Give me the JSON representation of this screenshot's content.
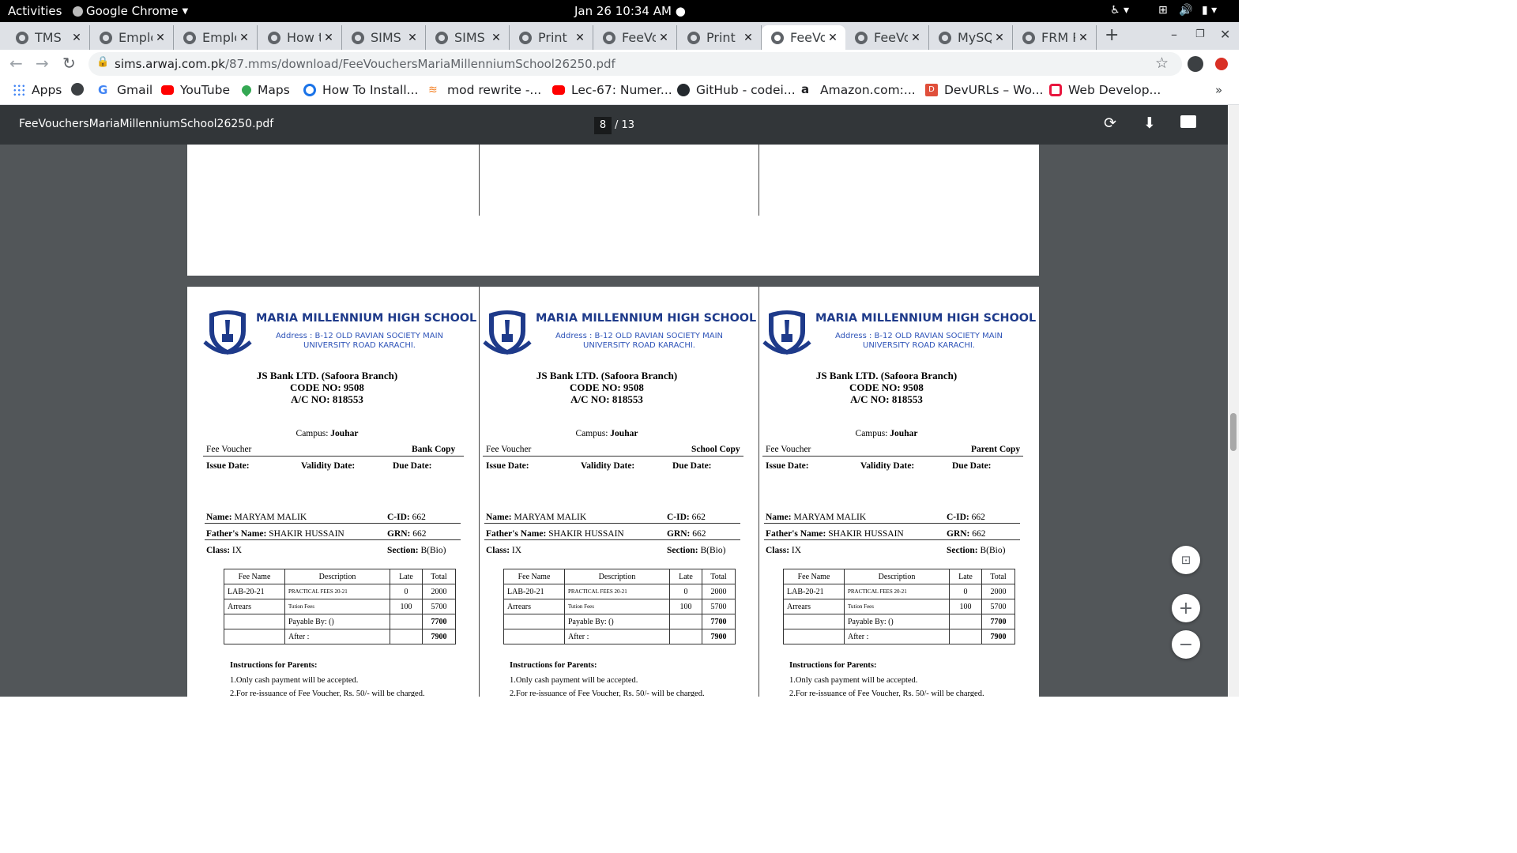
{
  "system": {
    "activities": "Activities",
    "app": "Google Chrome",
    "datetime": "Jan 26  10:34 AM"
  },
  "tabs": [
    {
      "label": "TMS"
    },
    {
      "label": "Emplo"
    },
    {
      "label": "Emplo"
    },
    {
      "label": "How t"
    },
    {
      "label": "SIMS -"
    },
    {
      "label": "SIMS -"
    },
    {
      "label": "Print I"
    },
    {
      "label": "FeeVo"
    },
    {
      "label": "Print I"
    },
    {
      "label": "FeeVo"
    },
    {
      "label": "FeeVo"
    },
    {
      "label": "MySQ"
    },
    {
      "label": "FRM P"
    }
  ],
  "active_tab_index": 9,
  "url": {
    "domain": "sims.arwaj.com.pk",
    "path": "/87.mms/download/FeeVouchersMariaMillenniumSchool26250.pdf"
  },
  "bookmarks": [
    {
      "label": "Apps"
    },
    {
      "label": ""
    },
    {
      "label": "Gmail"
    },
    {
      "label": "YouTube"
    },
    {
      "label": "Maps"
    },
    {
      "label": "How To Install..."
    },
    {
      "label": "mod rewrite -..."
    },
    {
      "label": "Lec-67: Numer..."
    },
    {
      "label": "GitHub - codei..."
    },
    {
      "label": "Amazon.com:..."
    },
    {
      "label": "DevURLs – Wo..."
    },
    {
      "label": "Web Develop..."
    }
  ],
  "pdf": {
    "filename": "FeeVouchersMariaMillenniumSchool26250.pdf",
    "current_page": "8",
    "total_pages": "/ 13"
  },
  "voucher_common": {
    "school": "MARIA MILLENNIUM HIGH SCHOOL",
    "address1": "Address : B-12 OLD RAVIAN SOCIETY MAIN",
    "address2": "UNIVERSITY ROAD KARACHI.",
    "bank": "JS Bank LTD. (Safoora Branch)",
    "code": "CODE NO: 9508",
    "account": "A/C NO: 818553",
    "campus_label": "Campus:",
    "campus": "Jouhar",
    "voucher_label": "Fee Voucher",
    "issue_date": "Issue Date:",
    "validity_date": "Validity Date:",
    "due_date": "Due Date:",
    "name_label": "Name:",
    "name": "MARYAM MALIK",
    "cid_label": "C-ID:",
    "cid": "662",
    "father_label": "Father's Name:",
    "father": "SHAKIR HUSSAIN",
    "grn_label": "GRN:",
    "grn": "662",
    "class_label": "Class:",
    "class": "IX",
    "section_label": "Section:",
    "section": "B(Bio)",
    "table_headers": [
      "Fee Name",
      "Description",
      "Late",
      "Total"
    ],
    "fee_rows": [
      {
        "name": "LAB-20-21",
        "desc": "PRACTICAL FEES 20-21",
        "late": "0",
        "total": "2000"
      },
      {
        "name": "Arrears",
        "desc": "Tution Fees",
        "late": "100",
        "total": "5700"
      }
    ],
    "payable_label": "Payable By: ()",
    "payable_total": "7700",
    "after_label": "After :",
    "after_total": "7900",
    "instructions_title": "Instructions for Parents:",
    "instruction_1": "1.Only cash payment will be accepted.",
    "instruction_2": "2.For re-issuance of Fee Voucher, Rs. 50/- will be charged."
  },
  "copies": [
    "Bank Copy",
    "School Copy",
    "Parent Copy"
  ]
}
